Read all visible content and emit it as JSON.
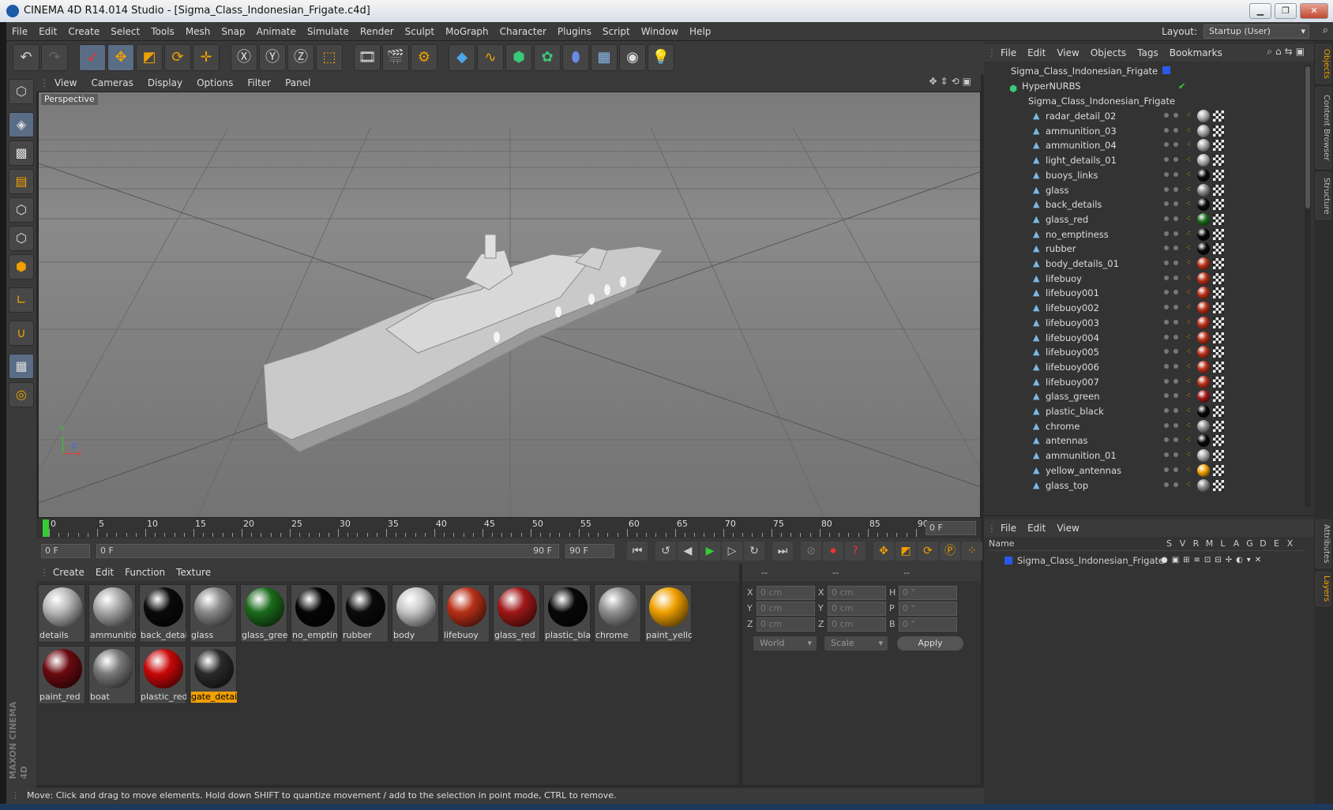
{
  "window": {
    "title": "CINEMA 4D R14.014 Studio - [Sigma_Class_Indonesian_Frigate.c4d]"
  },
  "menubar": {
    "items": [
      "File",
      "Edit",
      "Create",
      "Select",
      "Tools",
      "Mesh",
      "Snap",
      "Animate",
      "Simulate",
      "Render",
      "Sculpt",
      "MoGraph",
      "Character",
      "Plugins",
      "Script",
      "Window",
      "Help"
    ],
    "layout_label": "Layout:",
    "layout_value": "Startup (User)"
  },
  "viewport": {
    "menu": [
      "View",
      "Cameras",
      "Display",
      "Options",
      "Filter",
      "Panel"
    ],
    "label": "Perspective",
    "axis": {
      "y": "Y",
      "z": "Z",
      "x": "X"
    }
  },
  "timeline": {
    "ticks": [
      "0",
      "5",
      "10",
      "15",
      "20",
      "25",
      "30",
      "35",
      "40",
      "45",
      "50",
      "55",
      "60",
      "65",
      "70",
      "75",
      "80",
      "85",
      "90"
    ],
    "current_frame": "0 F",
    "start_field": "0 F",
    "range_start": "0 F",
    "range_end": "90 F",
    "end_field": "90 F"
  },
  "materials": {
    "menu": [
      "Create",
      "Edit",
      "Function",
      "Texture"
    ],
    "items": [
      {
        "name": "details",
        "color": "#b8b8b8",
        "selected": false
      },
      {
        "name": "ammunitio",
        "color": "#a8a8a8",
        "selected": false
      },
      {
        "name": "back_detai",
        "color": "#0a0a0a",
        "selected": false
      },
      {
        "name": "glass",
        "color": "#8a8a8a",
        "selected": false
      },
      {
        "name": "glass_greer",
        "color": "#1c6b1c",
        "selected": false
      },
      {
        "name": "no_emptin",
        "color": "#050505",
        "selected": false
      },
      {
        "name": "rubber",
        "color": "#0a0a0a",
        "selected": false
      },
      {
        "name": "body",
        "color": "#c8c8c8",
        "selected": false
      },
      {
        "name": "lifebuoy",
        "color": "#b83018",
        "selected": false
      },
      {
        "name": "glass_red",
        "color": "#a01818",
        "selected": false
      },
      {
        "name": "plastic_blac",
        "color": "#080808",
        "selected": false
      },
      {
        "name": "chrome",
        "color": "#909090",
        "selected": false
      },
      {
        "name": "paint_yello",
        "color": "#f0a000",
        "selected": false
      },
      {
        "name": "paint_red",
        "color": "#6a0a10",
        "selected": false
      },
      {
        "name": "boat",
        "color": "#7a7a7a",
        "selected": false
      },
      {
        "name": "plastic_red",
        "color": "#c80808",
        "selected": false
      },
      {
        "name": "gate_detail",
        "color": "#2a2a2a",
        "selected": true
      }
    ]
  },
  "coords": {
    "headers": [
      "--",
      "--",
      "--"
    ],
    "rows": [
      {
        "a": "X",
        "av": "0 cm",
        "b": "X",
        "bv": "0 cm",
        "c": "H",
        "cv": "0 °"
      },
      {
        "a": "Y",
        "av": "0 cm",
        "b": "Y",
        "bv": "0 cm",
        "c": "P",
        "cv": "0 °"
      },
      {
        "a": "Z",
        "av": "0 cm",
        "b": "Z",
        "bv": "0 cm",
        "c": "B",
        "cv": "0 °"
      }
    ],
    "world": "World",
    "scale": "Scale",
    "apply": "Apply"
  },
  "objects": {
    "menu": [
      "File",
      "Edit",
      "View",
      "Objects",
      "Tags",
      "Bookmarks"
    ],
    "tree": [
      {
        "name": "Sigma_Class_Indonesian_Frigate",
        "level": 0
      },
      {
        "name": "HyperNURBS",
        "level": 1
      },
      {
        "name": "Sigma_Class_Indonesian_Frigate",
        "level": 2
      }
    ],
    "children": [
      {
        "name": "radar_detail_02",
        "tag": "#b0b0b0"
      },
      {
        "name": "ammunition_03",
        "tag": "#a8a8a8"
      },
      {
        "name": "ammunition_04",
        "tag": "#a8a8a8"
      },
      {
        "name": "light_details_01",
        "tag": "#b0b0b0"
      },
      {
        "name": "buoys_links",
        "tag": "#0a0a0a"
      },
      {
        "name": "glass",
        "tag": "#8a8a8a"
      },
      {
        "name": "back_details",
        "tag": "#0a0a0a"
      },
      {
        "name": "glass_red",
        "tag": "#1c6b1c"
      },
      {
        "name": "no_emptiness",
        "tag": "#050505"
      },
      {
        "name": "rubber",
        "tag": "#0a0a0a"
      },
      {
        "name": "body_details_01",
        "tag": "#b83018"
      },
      {
        "name": "lifebuoy",
        "tag": "#b83018"
      },
      {
        "name": "lifebuoy001",
        "tag": "#b83018"
      },
      {
        "name": "lifebuoy002",
        "tag": "#b83018"
      },
      {
        "name": "lifebuoy003",
        "tag": "#b83018"
      },
      {
        "name": "lifebuoy004",
        "tag": "#b83018"
      },
      {
        "name": "lifebuoy005",
        "tag": "#b83018"
      },
      {
        "name": "lifebuoy006",
        "tag": "#b83018"
      },
      {
        "name": "lifebuoy007",
        "tag": "#b83018"
      },
      {
        "name": "glass_green",
        "tag": "#a01818"
      },
      {
        "name": "plastic_black",
        "tag": "#080808"
      },
      {
        "name": "chrome",
        "tag": "#909090"
      },
      {
        "name": "antennas",
        "tag": "#080808"
      },
      {
        "name": "ammunition_01",
        "tag": "#a8a8a8"
      },
      {
        "name": "yellow_antennas",
        "tag": "#f0a000"
      },
      {
        "name": "glass_top",
        "tag": "#8a8a8a"
      }
    ]
  },
  "layers": {
    "menu": [
      "File",
      "Edit",
      "View"
    ],
    "header_name": "Name",
    "header_cols": [
      "S",
      "V",
      "R",
      "M",
      "L",
      "A",
      "G",
      "D",
      "E",
      "X"
    ],
    "row_name": "Sigma_Class_Indonesian_Frigate"
  },
  "right_tabs": [
    "Objects",
    "Content Browser",
    "Structure",
    "Attributes",
    "Layers"
  ],
  "status": "Move: Click and drag to move elements. Hold down SHIFT to quantize movement / add to the selection in point mode, CTRL to remove.",
  "colors": {
    "accent": "#f0a000",
    "selected_tool": "#5a6d85",
    "background": "#333333"
  }
}
